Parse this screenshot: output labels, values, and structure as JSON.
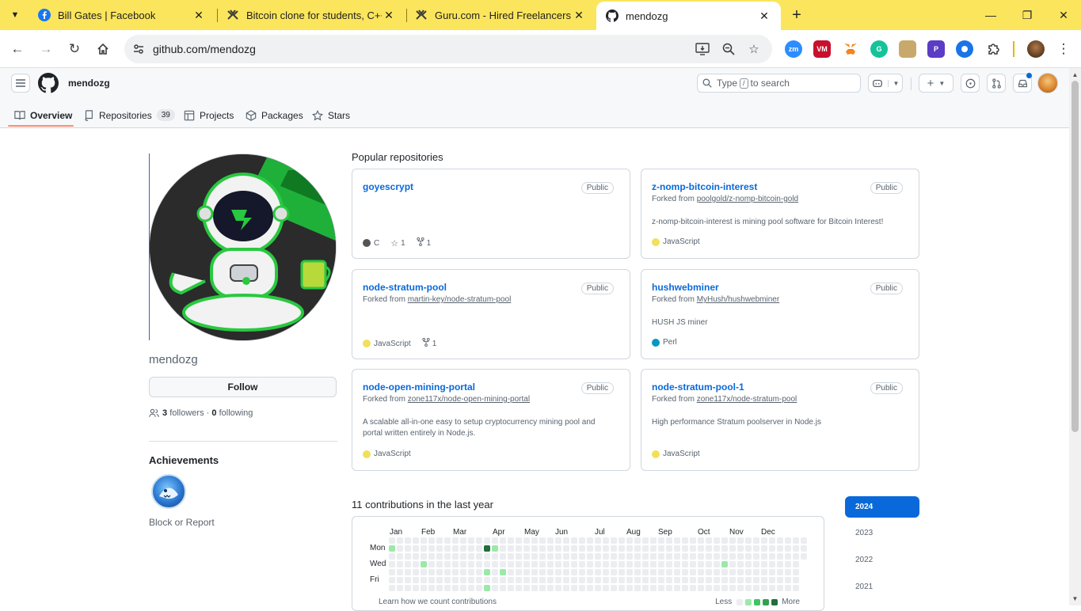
{
  "browser": {
    "tabs": [
      {
        "title": "Bill Gates | Facebook",
        "favicon": "facebook-icon"
      },
      {
        "title": "Bitcoin clone for students, C++",
        "favicon": "guru-icon"
      },
      {
        "title": "Guru.com - Hired Freelancers",
        "favicon": "guru-icon"
      },
      {
        "title": "mendozg",
        "favicon": "github-icon"
      }
    ],
    "url": "github.com/mendozg",
    "extensions": [
      {
        "label": "zm",
        "color": "#2d8cff"
      },
      {
        "label": "VM",
        "color": "#c8102e"
      },
      {
        "label": "",
        "color": "#f6851b"
      },
      {
        "label": "G",
        "color": "#15c39a"
      },
      {
        "label": "",
        "color": "#c9a96b"
      },
      {
        "label": "P",
        "color": "#5b3cc4"
      },
      {
        "label": "",
        "color": "#1a73e8"
      }
    ]
  },
  "github": {
    "username": "mendozg",
    "search_prefix": "Type",
    "search_key": "/",
    "search_suffix": "to search",
    "tabs": [
      {
        "label": "Overview",
        "icon": "book-icon"
      },
      {
        "label": "Repositories",
        "icon": "repo-icon",
        "count": "39"
      },
      {
        "label": "Projects",
        "icon": "table-icon"
      },
      {
        "label": "Packages",
        "icon": "package-icon"
      },
      {
        "label": "Stars",
        "icon": "star-icon"
      }
    ]
  },
  "profile": {
    "login": "mendozg",
    "follow_label": "Follow",
    "followers_count": "3",
    "followers_label": "followers",
    "dot": "·",
    "following_count": "0",
    "following_label": "following",
    "achievements_title": "Achievements",
    "block_report": "Block or Report"
  },
  "popular": {
    "title": "Popular repositories",
    "repos": [
      {
        "name": "goyescrypt",
        "badge": "Public",
        "forked_prefix": "",
        "forked_from": "",
        "description": "",
        "language": "C",
        "lang_color": "#555555",
        "stars": "1",
        "forks": "1"
      },
      {
        "name": "z-nomp-bitcoin-interest",
        "badge": "Public",
        "forked_prefix": "Forked from",
        "forked_from": "poolgold/z-nomp-bitcoin-gold",
        "description": "z-nomp-bitcoin-interest is mining pool software for Bitcoin Interest!",
        "language": "JavaScript",
        "lang_color": "#f1e05a",
        "stars": "",
        "forks": ""
      },
      {
        "name": "node-stratum-pool",
        "badge": "Public",
        "forked_prefix": "Forked from",
        "forked_from": "martin-key/node-stratum-pool",
        "description": "",
        "language": "JavaScript",
        "lang_color": "#f1e05a",
        "stars": "",
        "forks": "1"
      },
      {
        "name": "hushwebminer",
        "badge": "Public",
        "forked_prefix": "Forked from",
        "forked_from": "MyHush/hushwebminer",
        "description": "HUSH JS miner",
        "language": "Perl",
        "lang_color": "#0298c3",
        "stars": "",
        "forks": ""
      },
      {
        "name": "node-open-mining-portal",
        "badge": "Public",
        "forked_prefix": "Forked from",
        "forked_from": "zone117x/node-open-mining-portal",
        "description": "A scalable all-in-one easy to setup cryptocurrency mining pool and portal written entirely in Node.js.",
        "language": "JavaScript",
        "lang_color": "#f1e05a",
        "stars": "",
        "forks": ""
      },
      {
        "name": "node-stratum-pool-1",
        "badge": "Public",
        "forked_prefix": "Forked from",
        "forked_from": "zone117x/node-stratum-pool",
        "description": "High performance Stratum poolserver in Node.js",
        "language": "JavaScript",
        "lang_color": "#f1e05a",
        "stars": "",
        "forks": ""
      }
    ]
  },
  "contributions": {
    "title": "11 contributions in the last year",
    "months": [
      "Jan",
      "Feb",
      "Mar",
      "Apr",
      "May",
      "Jun",
      "Jul",
      "Aug",
      "Sep",
      "Oct",
      "Nov",
      "Dec"
    ],
    "day_labels": [
      "Mon",
      "Wed",
      "Fri"
    ],
    "learn_link": "Learn how we count contributions",
    "legend_less": "Less",
    "legend_more": "More",
    "legend_colors": [
      "#ebedf0",
      "#9be9a8",
      "#40c463",
      "#30a14e",
      "#216e39"
    ],
    "active_cells": [
      {
        "week": 0,
        "day": 1,
        "level": 1
      },
      {
        "week": 4,
        "day": 3,
        "level": 1
      },
      {
        "week": 12,
        "day": 1,
        "level": 4
      },
      {
        "week": 13,
        "day": 1,
        "level": 1
      },
      {
        "week": 12,
        "day": 4,
        "level": 1
      },
      {
        "week": 14,
        "day": 4,
        "level": 1
      },
      {
        "week": 12,
        "day": 6,
        "level": 1
      },
      {
        "week": 42,
        "day": 3,
        "level": 1
      }
    ],
    "years": [
      "2024",
      "2023",
      "2022",
      "2021"
    ],
    "selected_year": "2024"
  }
}
